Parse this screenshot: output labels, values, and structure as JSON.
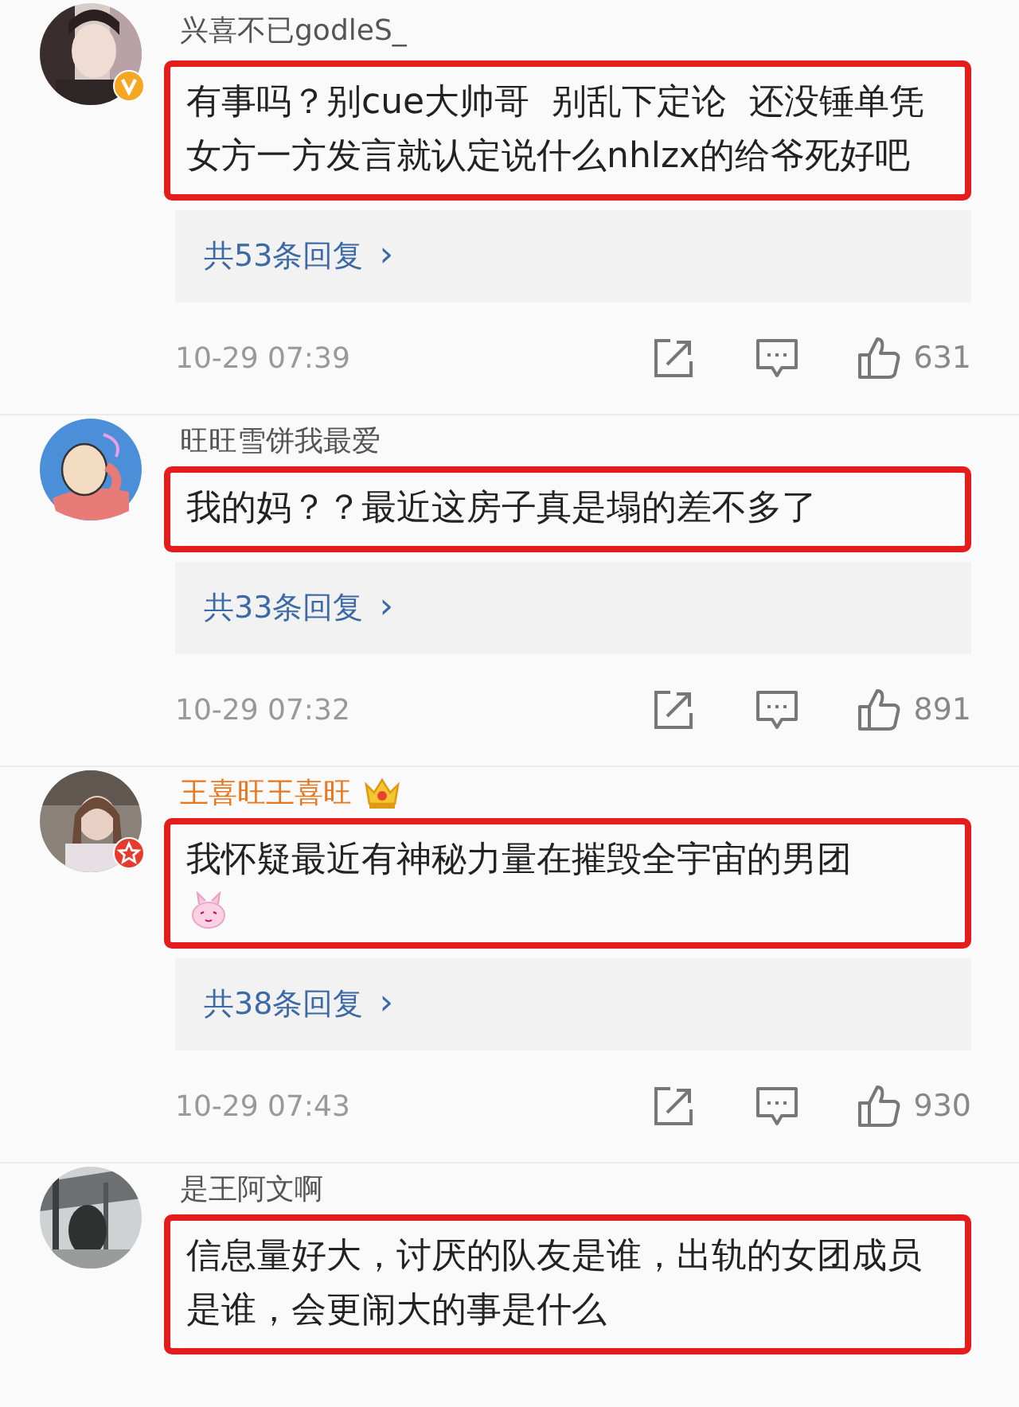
{
  "comments": [
    {
      "user": "兴喜不已godleS_",
      "vip": false,
      "badge": {
        "kind": "verified"
      },
      "text": "有事吗？别cue大帅哥  别乱下定论  还没锤单凭女方一方发言就认定说什么nhlzx的给爷死好吧",
      "highlighted": true,
      "replies": "共53条回复",
      "chevron": "›",
      "time": "10-29 07:39",
      "likes": "631"
    },
    {
      "user": "旺旺雪饼我最爱",
      "vip": false,
      "avatar": {
        "kind": "cartoon"
      },
      "text": "我的妈？？最近这房子真是塌的差不多了",
      "highlighted": true,
      "replies": "共33条回复",
      "chevron": "›",
      "time": "10-29 07:32",
      "likes": "891"
    },
    {
      "user": "王喜旺王喜旺",
      "vip": true,
      "badge": {
        "kind": "star"
      },
      "text": "我怀疑最近有神秘力量在摧毁全宇宙的男团",
      "emoji": {
        "kind": "bunny"
      },
      "highlighted": true,
      "replies": "共38条回复",
      "chevron": "›",
      "time": "10-29 07:43",
      "likes": "930"
    },
    {
      "user": "是王阿文啊",
      "vip": false,
      "text": "信息量好大，讨厌的队友是谁，出轨的女团成员是谁，会更闹大的事是什么",
      "highlighted": true
    }
  ]
}
